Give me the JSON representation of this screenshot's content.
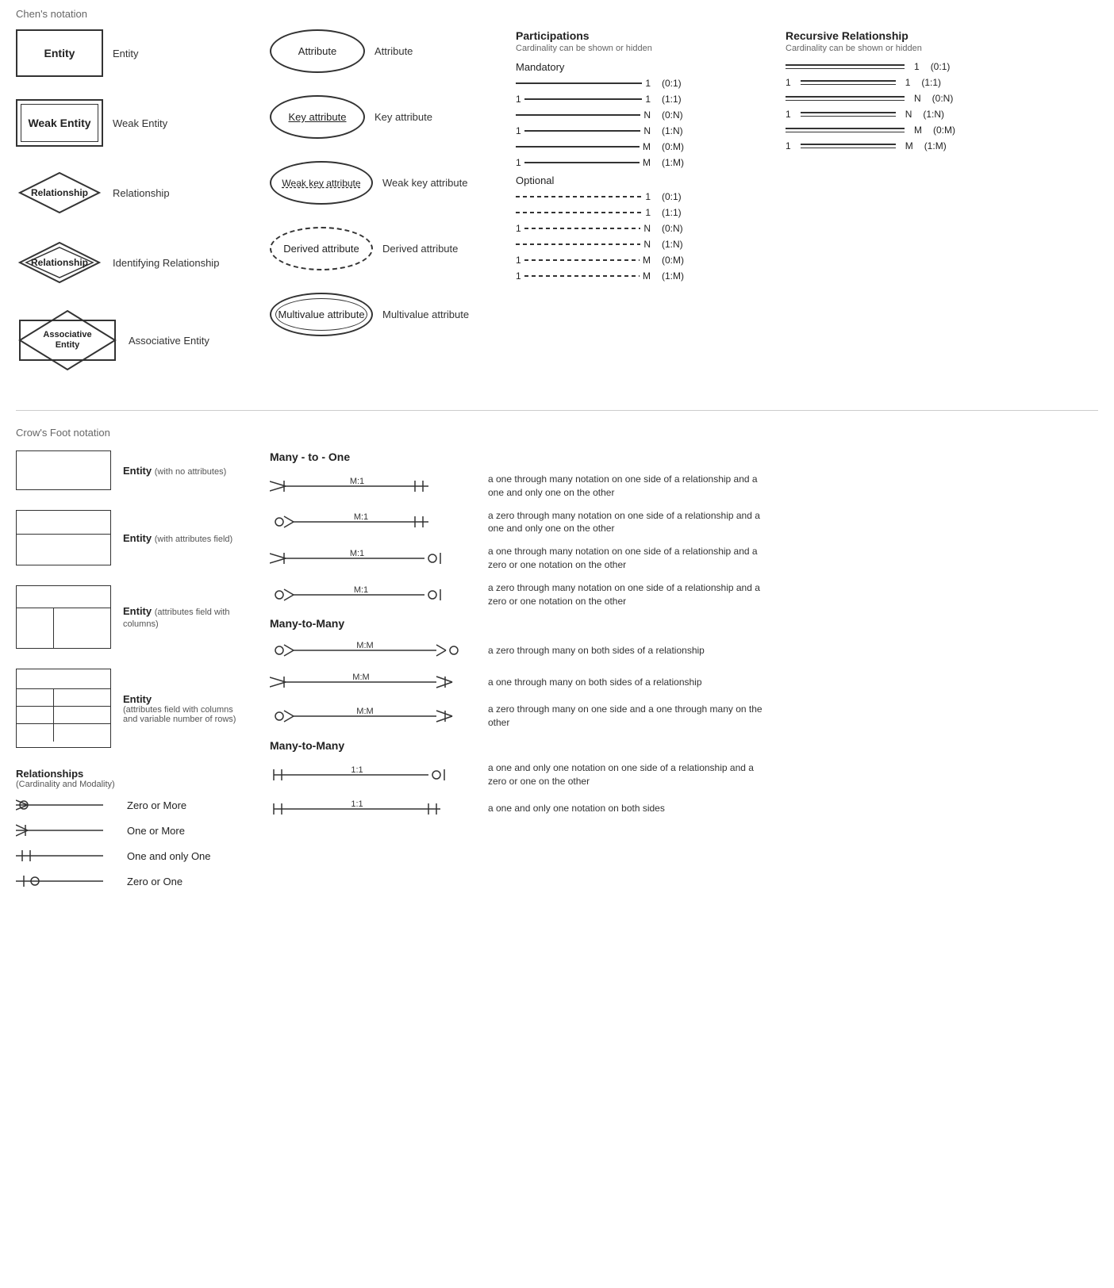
{
  "chens": {
    "header": "Chen's notation",
    "rows": [
      {
        "shape": "entity",
        "shapeLabel": "Entity",
        "label": "Entity"
      },
      {
        "shape": "weak-entity",
        "shapeLabel": "Weak Entity",
        "label": "Weak Entity"
      },
      {
        "shape": "relationship",
        "shapeLabel": "Relationship",
        "label": "Relationship"
      },
      {
        "shape": "identifying-relationship",
        "shapeLabel": "Relationship",
        "label": "Identifying Relationship"
      },
      {
        "shape": "associative-entity",
        "shapeLabel": "Associative\nEntity",
        "label": "Associative Entity"
      }
    ],
    "attrRows": [
      {
        "shape": "attribute",
        "shapeLabel": "Attribute",
        "label": "Attribute"
      },
      {
        "shape": "key-attribute",
        "shapeLabel": "Key attribute",
        "label": "Key attribute"
      },
      {
        "shape": "weak-key-attribute",
        "shapeLabel": "Weak key attribute",
        "label": "Weak key attribute"
      },
      {
        "shape": "derived-attribute",
        "shapeLabel": "Derived attribute",
        "label": "Derived attribute"
      },
      {
        "shape": "multivalue-attribute",
        "shapeLabel": "Multivalue attribute",
        "label": "Multivalue attribute"
      }
    ]
  },
  "participations": {
    "header": "Participations",
    "subheader": "Cardinality can be shown or hidden",
    "mandatory": {
      "title": "Mandatory",
      "rows": [
        {
          "leftNum": "",
          "rightNum": "1",
          "notation": "(0:1)"
        },
        {
          "leftNum": "1",
          "rightNum": "1",
          "notation": "(1:1)"
        },
        {
          "leftNum": "",
          "rightNum": "N",
          "notation": "(0:N)"
        },
        {
          "leftNum": "1",
          "rightNum": "N",
          "notation": "(1:N)"
        },
        {
          "leftNum": "",
          "rightNum": "M",
          "notation": "(0:M)"
        },
        {
          "leftNum": "1",
          "rightNum": "M",
          "notation": "(1:M)"
        }
      ]
    },
    "optional": {
      "title": "Optional",
      "rows": [
        {
          "leftNum": "",
          "rightNum": "1",
          "notation": "(0:1)"
        },
        {
          "leftNum": "",
          "rightNum": "1",
          "notation": "(1:1)"
        },
        {
          "leftNum": "1",
          "rightNum": "N",
          "notation": "(0:N)"
        },
        {
          "leftNum": "",
          "rightNum": "N",
          "notation": "(1:N)"
        },
        {
          "leftNum": "1",
          "rightNum": "M",
          "notation": "(0:M)"
        },
        {
          "leftNum": "1",
          "rightNum": "M",
          "notation": "(1:M)"
        }
      ]
    }
  },
  "recursive": {
    "header": "Recursive Relationship",
    "subheader": "Cardinality can be shown or hidden",
    "rows": [
      {
        "leftNum": "",
        "rightNum": "1",
        "notation": "(0:1)"
      },
      {
        "leftNum": "1",
        "rightNum": "1",
        "notation": "(1:1)"
      },
      {
        "leftNum": "",
        "rightNum": "N",
        "notation": "(0:N)"
      },
      {
        "leftNum": "1",
        "rightNum": "N",
        "notation": "(1:N)"
      },
      {
        "leftNum": "",
        "rightNum": "M",
        "notation": "(0:M)"
      },
      {
        "leftNum": "1",
        "rightNum": "M",
        "notation": "(1:M)"
      }
    ]
  },
  "crows": {
    "header": "Crow's Foot notation",
    "entities": [
      {
        "type": "simple",
        "label": "Entity",
        "sublabel": "(with no attributes)"
      },
      {
        "type": "attrs",
        "label": "Entity",
        "sublabel": "(with attributes field)"
      },
      {
        "type": "cols",
        "label": "Entity",
        "sublabel": "(attributes field with columns)"
      },
      {
        "type": "variable",
        "label": "Entity",
        "sublabel": "(attributes field with columns and variable number of rows)"
      }
    ],
    "relationships": {
      "title": "Relationships",
      "subtitle": "(Cardinality and Modality)",
      "legend": [
        {
          "type": "zero-or-more",
          "label": "Zero or More"
        },
        {
          "type": "one-or-more",
          "label": "One or More"
        },
        {
          "type": "one-and-only-one",
          "label": "One and only One"
        },
        {
          "type": "zero-or-one",
          "label": "Zero or One"
        }
      ]
    },
    "manyToOne": {
      "title": "Many - to - One",
      "rows": [
        {
          "leftType": "one-or-more",
          "label": "M:1",
          "rightType": "one-and-only-one",
          "desc": "a one through many notation on one side of a relationship and a one and only one on the other"
        },
        {
          "leftType": "zero-or-more",
          "label": "M:1",
          "rightType": "one-and-only-one",
          "desc": "a zero through many notation on one side of a relationship and a one and only one on the other"
        },
        {
          "leftType": "one-or-more",
          "label": "M:1",
          "rightType": "zero-or-one",
          "desc": "a one through many notation on one side of a relationship and a zero or one notation on the other"
        },
        {
          "leftType": "zero-or-more",
          "label": "M:1",
          "rightType": "zero-or-one",
          "desc": "a zero through many notation on one side of a relationship and a zero or one notation on the other"
        }
      ]
    },
    "manyToMany1": {
      "title": "Many-to-Many",
      "rows": [
        {
          "leftType": "zero-or-more",
          "label": "M:M",
          "rightType": "zero-or-more-r",
          "desc": "a zero through many on both sides of a relationship"
        },
        {
          "leftType": "one-or-more",
          "label": "M:M",
          "rightType": "one-or-more-r",
          "desc": "a one through many on both sides of a relationship"
        },
        {
          "leftType": "zero-or-more",
          "label": "M:M",
          "rightType": "one-or-more-r",
          "desc": "a zero through many on one side and a one through many on the other"
        }
      ]
    },
    "manyToMany2": {
      "title": "Many-to-Many",
      "rows": [
        {
          "leftType": "one-and-only-one",
          "label": "1:1",
          "rightType": "zero-or-one",
          "desc": "a one and only one notation on one side of a relationship and a zero or one on the other"
        },
        {
          "leftType": "one-and-only-one",
          "label": "1:1",
          "rightType": "one-and-only-one-r",
          "desc": "a one and only one notation on both sides"
        }
      ]
    }
  }
}
